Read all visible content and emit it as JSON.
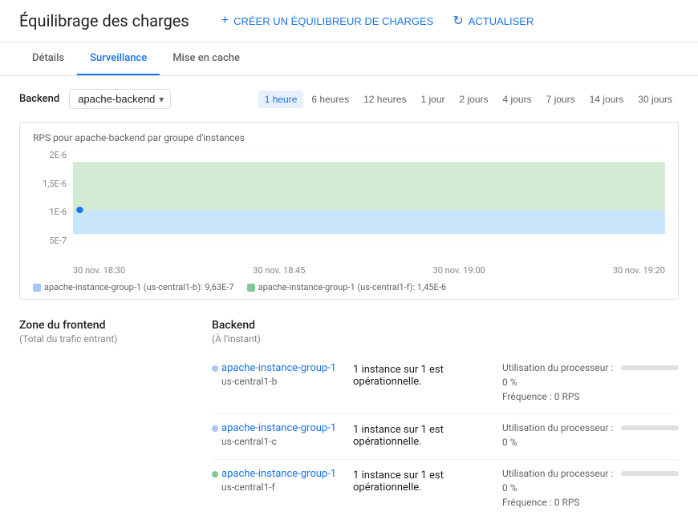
{
  "header": {
    "title": "Équilibrage des charges",
    "create_btn": "CRÉER UN ÉQUILIBREUR DE CHARGES",
    "refresh_btn": "ACTUALISER"
  },
  "tabs": [
    {
      "id": "details",
      "label": "Détails",
      "active": false
    },
    {
      "id": "surveillance",
      "label": "Surveillance",
      "active": true
    },
    {
      "id": "cache",
      "label": "Mise en cache",
      "active": false
    }
  ],
  "toolbar": {
    "backend_label": "Backend",
    "backend_value": "apache-backend",
    "time_filters": [
      {
        "label": "1 heure",
        "active": true
      },
      {
        "label": "6 heures",
        "active": false
      },
      {
        "label": "12 heures",
        "active": false
      },
      {
        "label": "1 jour",
        "active": false
      },
      {
        "label": "2 jours",
        "active": false
      },
      {
        "label": "4 jours",
        "active": false
      },
      {
        "label": "7 jours",
        "active": false
      },
      {
        "label": "14 jours",
        "active": false
      },
      {
        "label": "30 jours",
        "active": false
      }
    ]
  },
  "chart": {
    "title": "RPS pour apache-backend par groupe d'instances",
    "y_labels": [
      "2E-6",
      "1,5E-6",
      "1E-6",
      "5E-7"
    ],
    "x_labels": [
      "30 nov. 18:30",
      "30 nov. 18:45",
      "30 nov. 19:00",
      "30 nov. 19:20"
    ],
    "legend": [
      {
        "color": "#a8c7fa",
        "label": "apache-instance-group-1 (us-central1-b): 9,63E-7"
      },
      {
        "color": "#81c995",
        "label": "apache-instance-group-1 (us-central1-f): 1,45E-6"
      }
    ]
  },
  "frontend": {
    "title": "Zone du frontend",
    "subtitle": "(Total du trafic entrant)"
  },
  "backend_section": {
    "title": "Backend",
    "subtitle": "(À l'instant)",
    "rows": [
      {
        "dot_color": "#a8c7fa",
        "instance_name": "apache-instance-group-1",
        "location": "us-central1-b",
        "status": "1 instance sur 1 est opérationnelle.",
        "cpu_label": "Utilisation du processeur :",
        "cpu_pct": 0,
        "cpu_bar": 0,
        "freq_label": "Fréquence : 0 RPS",
        "show_freq": true
      },
      {
        "dot_color": "#a8c7fa",
        "instance_name": "apache-instance-group-1",
        "location": "us-central1-c",
        "status": "1 instance sur 1 est opérationnelle.",
        "cpu_label": "Utilisation du processeur :",
        "cpu_pct": 0,
        "cpu_bar": 0,
        "freq_label": "",
        "show_freq": false
      },
      {
        "dot_color": "#81c995",
        "instance_name": "apache-instance-group-1",
        "location": "us-central1-f",
        "status": "1 instance sur 1 est opérationnelle.",
        "cpu_label": "Utilisation du processeur :",
        "cpu_pct": 0,
        "cpu_bar": 0,
        "freq_label": "Fréquence : 0 RPS",
        "show_freq": true
      }
    ]
  }
}
